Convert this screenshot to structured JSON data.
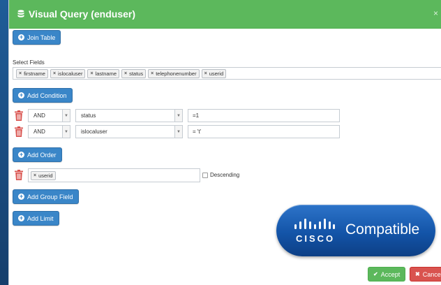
{
  "modal": {
    "title": "Visual Query (enduser)",
    "close_label": "×"
  },
  "buttons": {
    "join_table": "Join Table",
    "add_condition": "Add Condition",
    "add_order": "Add Order",
    "add_group_field": "Add Group Field",
    "add_limit": "Add Limit",
    "accept": "Accept",
    "cancel": "Cancel"
  },
  "select_fields": {
    "label": "Select Fields",
    "tags": [
      "firstname",
      "islocaluser",
      "lastname",
      "status",
      "telephonenumber",
      "userid"
    ]
  },
  "conditions": [
    {
      "operator": "AND",
      "field": "status",
      "value": "=1"
    },
    {
      "operator": "AND",
      "field": "islocaluser",
      "value": "= 't'"
    }
  ],
  "order": {
    "tag": "userid",
    "descending_label": "Descending",
    "descending_checked": false
  },
  "badge": {
    "brand": "CISCO",
    "text": "Compatible"
  },
  "colors": {
    "header": "#5cb85c",
    "primary": "#3a86c8",
    "accept": "#5cb85c",
    "cancel": "#d9534f",
    "trash": "#d9534f",
    "badge": "#1a5fb4"
  },
  "icons": {
    "header": "database-icon",
    "add": "plus-circle-icon",
    "delete": "trash-icon",
    "accept": "check-icon",
    "cancel": "times-icon"
  }
}
